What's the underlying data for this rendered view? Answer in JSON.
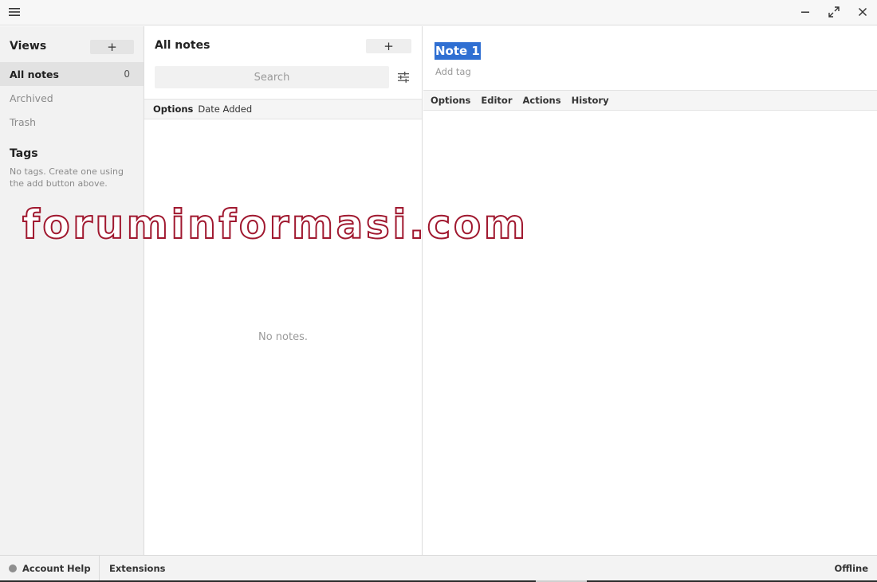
{
  "titlebar": {
    "menu_icon": "hamburger-menu-icon",
    "minimize_icon": "minimize-icon",
    "maximize_icon": "maximize-icon",
    "close_icon": "close-icon"
  },
  "sidebar": {
    "views_title": "Views",
    "add_label": "+",
    "items": [
      {
        "label": "All notes",
        "count": "0",
        "active": true
      },
      {
        "label": "Archived",
        "active": false
      },
      {
        "label": "Trash",
        "active": false
      }
    ],
    "tags_title": "Tags",
    "tags_empty": "No tags. Create one using the add button above."
  },
  "notes": {
    "title": "All notes",
    "add_label": "+",
    "search_placeholder": "Search",
    "filter_icon": "sliders-icon",
    "toolbar": {
      "options_label": "Options",
      "sort_label": "Date Added"
    },
    "empty_text": "No notes."
  },
  "editor": {
    "note_title": "Note 1",
    "add_tag": "Add tag",
    "menu": [
      "Options",
      "Editor",
      "Actions",
      "History"
    ],
    "title_highlight_color": "#2f6fd2"
  },
  "watermark": {
    "text": "foruminformasi.com",
    "color": "#a0182f"
  },
  "footer": {
    "account_label": "Account",
    "help_label": "Help",
    "extensions_label": "Extensions",
    "status": "Offline",
    "status_dot_color": "#8f8f8f"
  }
}
